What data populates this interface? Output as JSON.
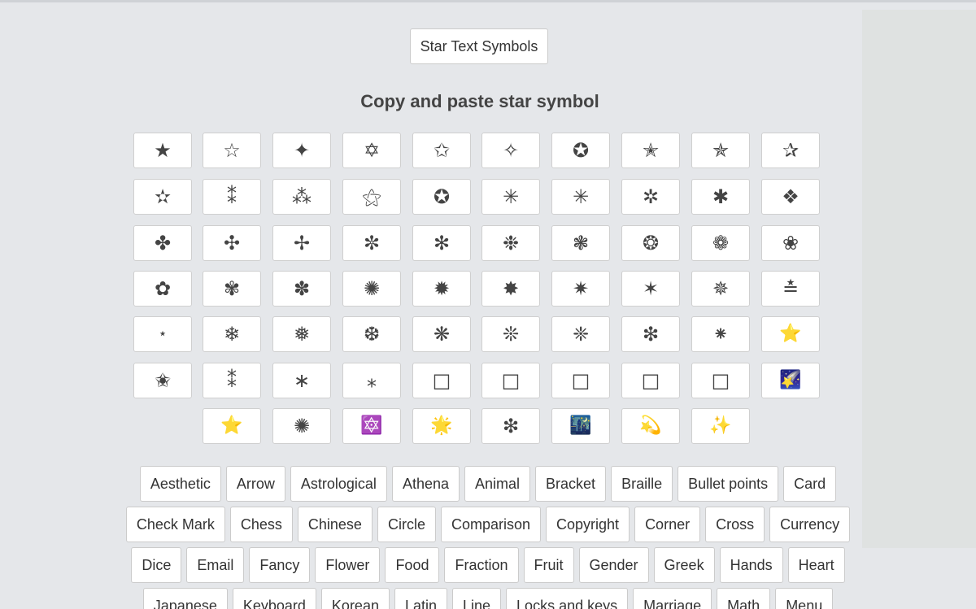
{
  "header": {
    "title_button": "Star Text Symbols",
    "heading": "Copy and paste star symbol"
  },
  "symbol_rows": [
    [
      "★",
      "☆",
      "✦",
      "✡",
      "✩",
      "✧",
      "✪",
      "✭",
      "✯",
      "✰"
    ],
    [
      "✫",
      "⁑",
      "⁂",
      "⚝",
      "✪",
      "✳",
      "✳",
      "✲",
      "✱",
      "❖"
    ],
    [
      "✤",
      "✣",
      "✢",
      "✼",
      "✻",
      "❉",
      "❃",
      "❂",
      "❁",
      "❀"
    ],
    [
      "✿",
      "✾",
      "✽",
      "✺",
      "✹",
      "✸",
      "✷",
      "✶",
      "✵",
      "≛"
    ],
    [
      "⋆",
      "❄",
      "❅",
      "❆",
      "❋",
      "❊",
      "❈",
      "❇",
      "⁕",
      "⭐"
    ],
    [
      "✬",
      "⁑",
      "∗",
      "⁎",
      "□",
      "□",
      "□",
      "□",
      "□",
      "🌠"
    ],
    [
      "⭐",
      "✺",
      "🔯",
      "🌟",
      "❇",
      "🌃",
      "💫",
      "✨"
    ]
  ],
  "tag_rows": [
    [
      "Aesthetic",
      "Arrow",
      "Astrological",
      "Athena",
      "Animal",
      "Bracket",
      "Braille",
      "Bullet points",
      "Card"
    ],
    [
      "Check Mark",
      "Chess",
      "Chinese",
      "Circle",
      "Comparison",
      "Copyright",
      "Corner",
      "Cross",
      "Currency"
    ],
    [
      "Dice",
      "Email",
      "Fancy",
      "Flower",
      "Food",
      "Fraction",
      "Fruit",
      "Gender",
      "Greek",
      "Hands",
      "Heart"
    ],
    [
      "Japanese",
      "Keyboard",
      "Korean",
      "Latin",
      "Line",
      "Locks and keys",
      "Marriage",
      "Math",
      "Menu"
    ]
  ]
}
